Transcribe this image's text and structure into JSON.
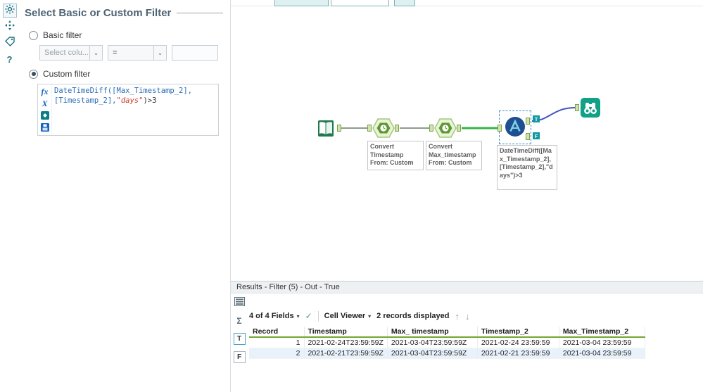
{
  "colors": {
    "accent_green": "#71a832",
    "wire_green": "#35b44a",
    "wire_blue": "#4453c5",
    "tool_teal": "#11a187",
    "selection_blue": "#3f8fc9"
  },
  "left_rail": {
    "icons": [
      "configuration-gear",
      "navigation",
      "annotation-tag",
      "help"
    ],
    "help_glyph": "?"
  },
  "config_panel": {
    "title": "Select Basic or Custom Filter",
    "basic_filter": {
      "label": "Basic filter",
      "selected": false
    },
    "custom_filter": {
      "label": "Custom filter",
      "selected": true
    },
    "column_dropdown": {
      "placeholder": "Select colu..."
    },
    "operator_dropdown": {
      "value": "="
    },
    "value_input": {
      "value": ""
    },
    "expression": {
      "l1": "DateTimeDiff([Max_Timestamp_2],",
      "l2_field": "[Timestamp_2],",
      "l2_string": "\"days\"",
      "l2_rest": ")>3"
    },
    "expression_rail_icons": [
      "functions-fx",
      "variables-x",
      "constants",
      "save-expression"
    ]
  },
  "canvas": {
    "tools": [
      "input-data-tool",
      "datetime-tool",
      "datetime-tool",
      "filter-macro-tool",
      "browse-tool"
    ],
    "filter_outputs": {
      "true": "T",
      "false": "F"
    },
    "annotations": [
      "Convert Timestamp From: Custom",
      "Convert Max_timestamp From: Custom",
      "DateTimeDiff([Max_Timestamp_2],[Timestamp_2],\"days\")>3"
    ]
  },
  "results": {
    "header": "Results - Filter (5) - Out - True",
    "toolbar": {
      "fields": "4 of 4 Fields",
      "caret": "▾",
      "check": "✓",
      "cell_viewer": "Cell Viewer",
      "records": "2 records displayed",
      "up": "↑",
      "down": "↓"
    },
    "strip_icons": [
      "records-table",
      "sigma-profile"
    ],
    "sigma_glyph": "Σ",
    "output_tabs": {
      "true": "T",
      "false": "F"
    },
    "table": {
      "columns": [
        "Record",
        "Timestamp",
        "Max_ timestamp",
        "Timestamp_2",
        "Max_Timestamp_2"
      ],
      "rows": [
        [
          "1",
          "2021-02-24T23:59:59Z",
          "2021-03-04T23:59:59Z",
          "2021-02-24 23:59:59",
          "2021-03-04 23:59:59"
        ],
        [
          "2",
          "2021-02-21T23:59:59Z",
          "2021-03-04T23:59:59Z",
          "2021-02-21 23:59:59",
          "2021-03-04 23:59:59"
        ]
      ]
    }
  }
}
